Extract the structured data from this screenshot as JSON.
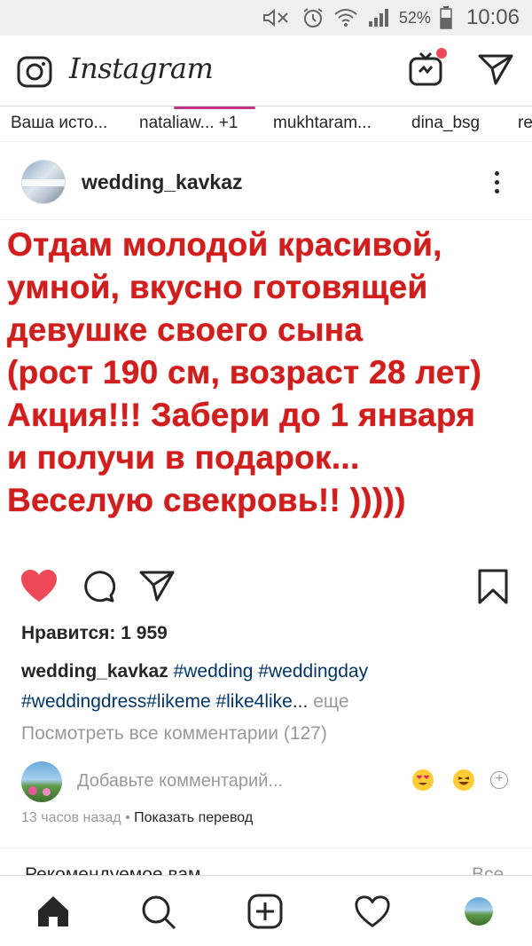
{
  "status_bar": {
    "battery_percent": "52%",
    "time": "10:06",
    "icons": [
      "mute-icon",
      "alarm-icon",
      "wifi-icon",
      "signal-icon",
      "battery-icon"
    ]
  },
  "header": {
    "app_title": "Instagram",
    "icons": [
      "camera-icon",
      "igtv-icon",
      "direct-message-icon"
    ],
    "notification_dot_color": "#ed4956"
  },
  "stories": [
    {
      "label": "Ваша исто..."
    },
    {
      "label": "nataliaw...  +1"
    },
    {
      "label": "mukhtaram..."
    },
    {
      "label": "dina_bsg"
    },
    {
      "label": "re"
    }
  ],
  "post": {
    "username": "wedding_kavkaz",
    "avatar_text": "WEDDING KAVKAZ",
    "image_text": [
      "Отдам молодой красивой,",
      "умной, вкусно готовящей",
      "девушке своего сына",
      "(рост 190 см, возраст 28 лет)",
      "Акция!!! Забери до 1 января",
      "и получи в подарок...",
      "Веселую свекровь!! )))))"
    ],
    "image_text_color": "#d21d1d",
    "liked": true,
    "like_color": "#ed4956",
    "likes_text": "Нравится: 1 959",
    "caption_user": "wedding_kavkaz",
    "caption_line1_tags": "#wedding #weddingday",
    "caption_line2_tags": "#weddingdress#likeme #like4like",
    "caption_ellipsis": "...",
    "caption_more": "еще",
    "view_comments": "Посмотреть все комментарии (127)",
    "comment_placeholder": "Добавьте комментарий...",
    "timestamp": "13 часов назад",
    "separator": " • ",
    "translate_link": "Показать перевод"
  },
  "suggestions": {
    "title": "Рекомендуемое вам",
    "see_all": "Все"
  },
  "bottom_nav": [
    "home-icon",
    "search-icon",
    "new-post-icon",
    "activity-icon",
    "profile-avatar"
  ]
}
